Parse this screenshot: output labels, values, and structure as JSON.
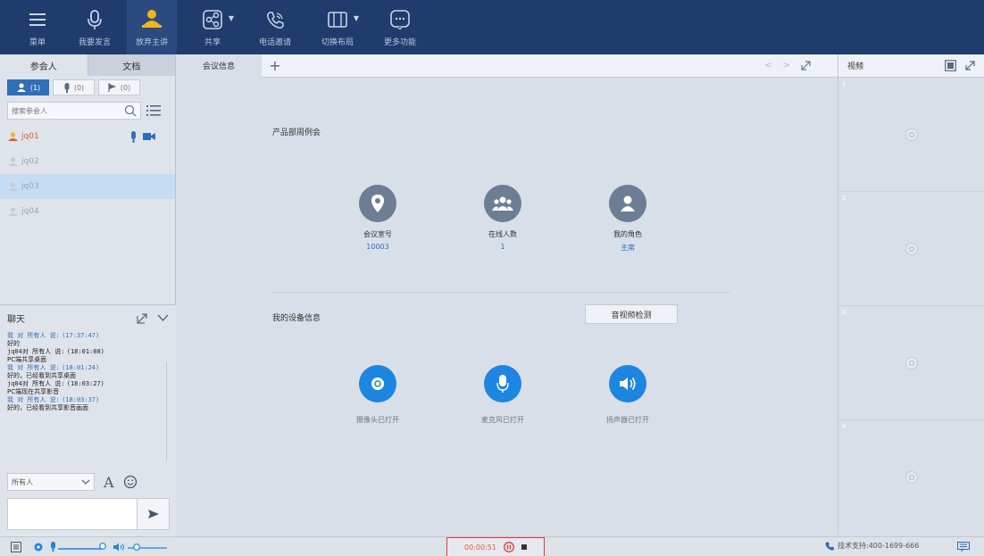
{
  "toolbar": {
    "items": [
      {
        "label": "菜单",
        "icon": "menu-icon"
      },
      {
        "label": "我要发言",
        "icon": "microphone-icon"
      },
      {
        "label": "放弃主讲",
        "icon": "presenter-icon"
      },
      {
        "label": "共享",
        "icon": "share-icon"
      },
      {
        "label": "电话邀请",
        "icon": "phone-icon"
      },
      {
        "label": "切换布局",
        "icon": "layout-icon"
      },
      {
        "label": "更多功能",
        "icon": "more-icon"
      }
    ]
  },
  "left": {
    "tabs": [
      "参会人",
      "文档"
    ],
    "filters": [
      {
        "count": "(1)",
        "icon": "user-icon"
      },
      {
        "count": "(0)",
        "icon": "microphone-icon"
      },
      {
        "count": "(0)",
        "icon": "flag-icon"
      }
    ],
    "search": {
      "placeholder": "搜索参会人"
    },
    "participants": [
      {
        "name": "jq01",
        "state": "self"
      },
      {
        "name": "jq02",
        "state": "offline"
      },
      {
        "name": "jq03",
        "state": "selected"
      },
      {
        "name": "jq04",
        "state": "offline"
      }
    ]
  },
  "chat": {
    "title": "聊天",
    "messages": [
      {
        "sender": "我 对 所有人 说:",
        "time": "(17:37:47)",
        "text": "好的"
      },
      {
        "sender": "jq04对 所有人 说:",
        "time": "(18:01:08)",
        "text": "PC端共享桌面"
      },
      {
        "sender": "我 对 所有人 说:",
        "time": "(18:01:24)",
        "text": "好的，已经看到共享桌面"
      },
      {
        "sender": "jq04对 所有人 说:",
        "time": "(18:03:27)",
        "text": "PC端现在共享影音"
      },
      {
        "sender": "我 对 所有人 说:",
        "time": "(18:03:37)",
        "text": "好的，已经看到共享影音画面"
      }
    ],
    "recipient": "所有人"
  },
  "center": {
    "tab": "会议信息",
    "meeting_name": "产品部周例会",
    "stats": [
      {
        "label": "会议室号",
        "value": "10003"
      },
      {
        "label": "在线人数",
        "value": "1"
      },
      {
        "label": "我的角色",
        "value": "主席"
      }
    ],
    "device_title": "我的设备信息",
    "check_button": "音视频检测",
    "devices": [
      {
        "label": "摄像头已打开"
      },
      {
        "label": "麦克风已打开"
      },
      {
        "label": "扬声器已打开"
      }
    ]
  },
  "right": {
    "title": "视频",
    "slots": [
      "1",
      "2",
      "3",
      "4"
    ]
  },
  "status": {
    "timer": "00:00:51",
    "support": "技术支持:400-1699-666"
  },
  "colors": {
    "toolbar_bg": "#1f3c6c",
    "accent_blue": "#1d86e0",
    "alert_red": "#e23b3b"
  }
}
